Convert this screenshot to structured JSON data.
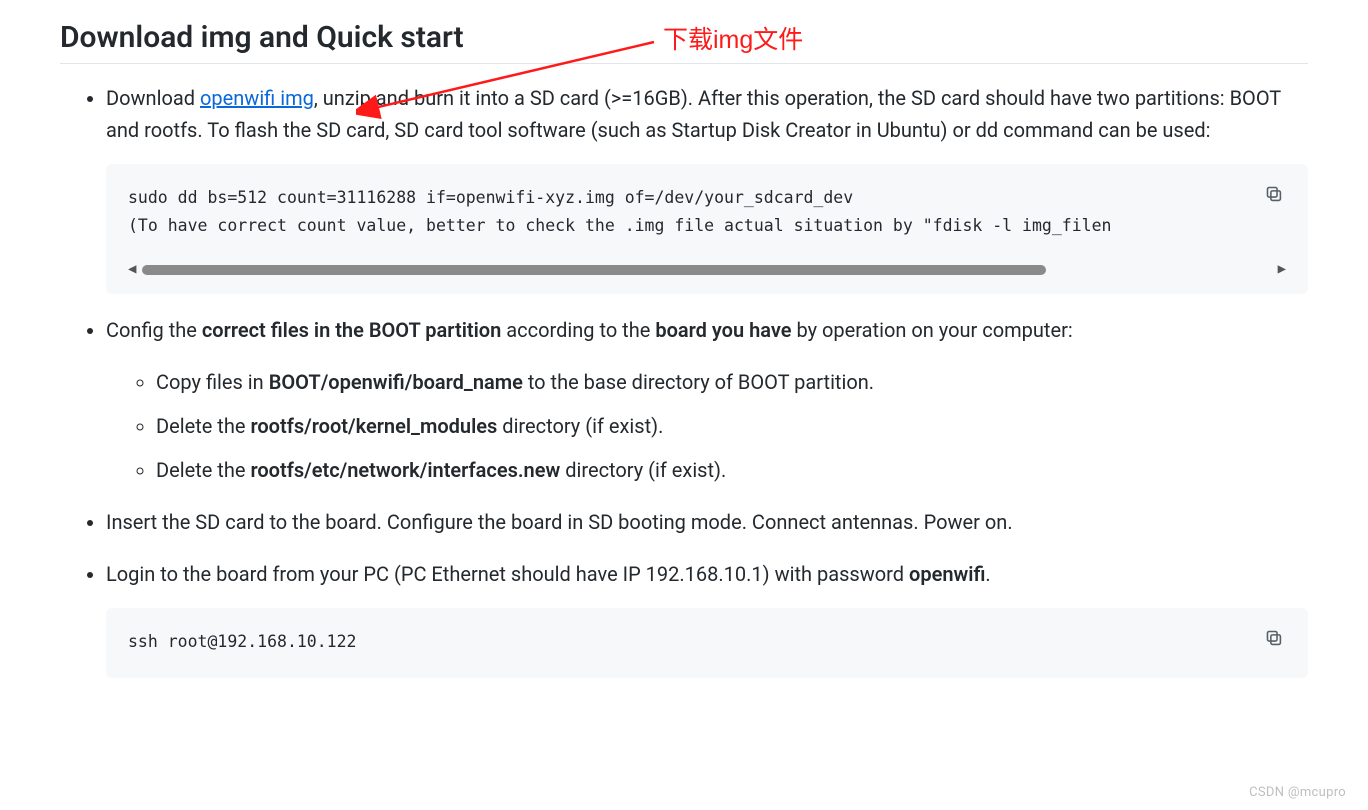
{
  "heading": "Download img and Quick start",
  "annotation_text": "下载img文件",
  "b1": {
    "pre": "Download ",
    "link": "openwifi img",
    "post": ", unzip and burn it into a SD card (>=16GB). After this operation, the SD card should have two partitions: BOOT and rootfs. To flash the SD card, SD card tool software (such as Startup Disk Creator in Ubuntu) or dd command can be used:"
  },
  "code1": {
    "l1": "sudo dd bs=512 count=31116288 if=openwifi-xyz.img of=/dev/your_sdcard_dev",
    "l2": "(To have correct count value, better to check the .img file actual situation by \"fdisk -l img_filen"
  },
  "b2": {
    "pre": "Config the ",
    "s1": "correct files in the BOOT partition",
    "mid": " according to the ",
    "s2": "board you have",
    "post": " by operation on your computer:"
  },
  "sub": {
    "i1": {
      "pre": "Copy files in ",
      "s": "BOOT/openwifi/board_name",
      "post": " to the base directory of BOOT partition."
    },
    "i2": {
      "pre": "Delete the ",
      "s": "rootfs/root/kernel_modules",
      "post": " directory (if exist)."
    },
    "i3": {
      "pre": "Delete the ",
      "s": "rootfs/etc/network/interfaces.new",
      "post": " directory (if exist)."
    }
  },
  "b3": "Insert the SD card to the board. Configure the board in SD booting mode. Connect antennas. Power on.",
  "b4": {
    "pre": "Login to the board from your PC (PC Ethernet should have IP 192.168.10.1) with password ",
    "s": "openwifi",
    "post": "."
  },
  "code2": {
    "l1": "ssh root@192.168.10.122"
  },
  "watermark": "CSDN @mcupro",
  "scroll": {
    "left": "◀",
    "right": "▶"
  }
}
